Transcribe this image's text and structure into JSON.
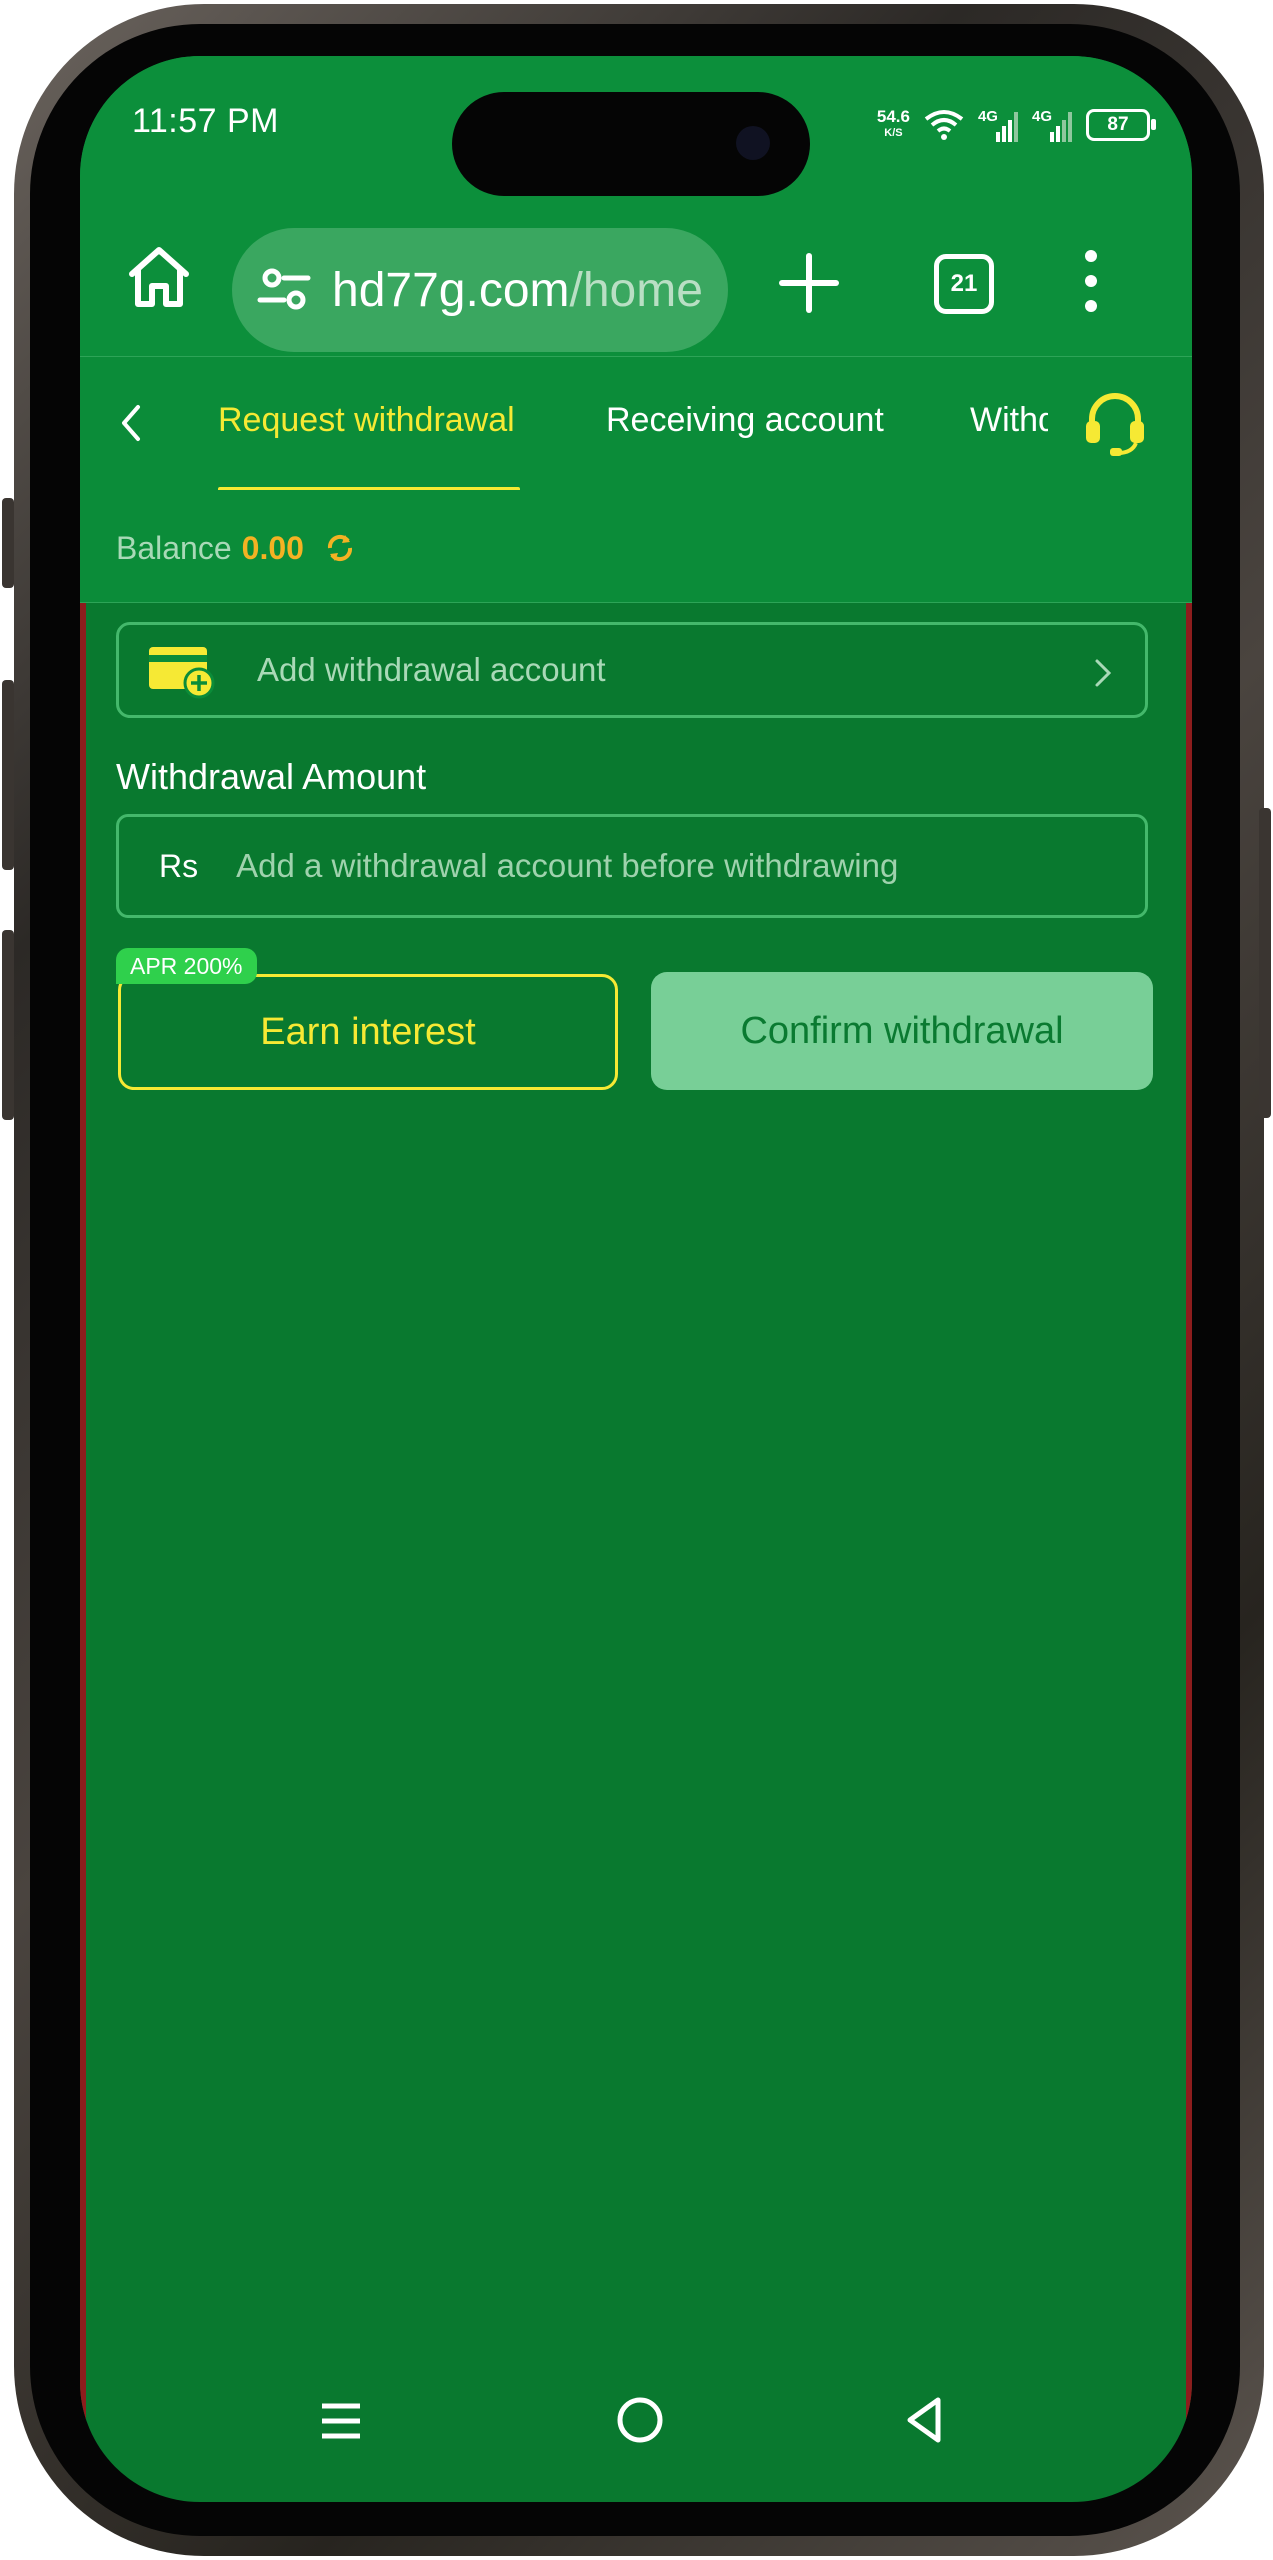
{
  "status_bar": {
    "time": "11:57 PM",
    "speed_value": "54.6",
    "speed_unit": "K/S",
    "net1": "4G",
    "net2": "4G",
    "battery": "87"
  },
  "browser": {
    "url_domain": "hd77g.com",
    "url_path": "/home",
    "tab_count": "21"
  },
  "tabs": [
    {
      "label": "Request withdrawal",
      "active": true
    },
    {
      "label": "Receiving account",
      "active": false
    },
    {
      "label": "Withdrawal",
      "active": false
    }
  ],
  "balance": {
    "label": "Balance",
    "value": "0.00"
  },
  "add_account": {
    "label": "Add withdrawal account"
  },
  "withdrawal_amount": {
    "title": "Withdrawal Amount",
    "currency": "Rs",
    "placeholder": "Add a withdrawal account before withdrawing"
  },
  "actions": {
    "apr_badge": "APR 200%",
    "earn_label": "Earn interest",
    "confirm_label": "Confirm withdrawal"
  },
  "colors": {
    "page_bg": "#09792f",
    "header_bg": "#0c8f3b",
    "accent_yellow": "#f6e934",
    "balance_orange": "#f4b223",
    "badge_green": "#2fd04c",
    "confirm_bg": "#78cf97"
  }
}
